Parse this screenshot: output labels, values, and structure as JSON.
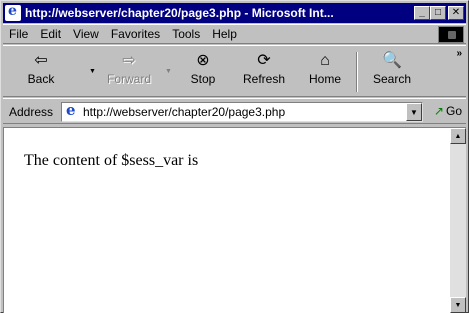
{
  "window": {
    "title": "http://webserver/chapter20/page3.php - Microsoft Int...",
    "minimize_label": "_",
    "maximize_label": "□",
    "close_label": "✕"
  },
  "menu": {
    "items": [
      {
        "label": "File"
      },
      {
        "label": "Edit"
      },
      {
        "label": "View"
      },
      {
        "label": "Favorites"
      },
      {
        "label": "Tools"
      },
      {
        "label": "Help"
      }
    ]
  },
  "toolbar": {
    "back": {
      "label": "Back",
      "icon": "⇦"
    },
    "forward": {
      "label": "Forward",
      "icon": "⇨"
    },
    "stop": {
      "label": "Stop",
      "icon": "⊗"
    },
    "refresh": {
      "label": "Refresh",
      "icon": "⟳"
    },
    "home": {
      "label": "Home",
      "icon": "⌂"
    },
    "search": {
      "label": "Search",
      "icon": "🔍"
    },
    "chevrons": "»"
  },
  "address": {
    "label": "Address",
    "url": "http://webserver/chapter20/page3.php",
    "go_label": "Go",
    "go_icon": "↗"
  },
  "page": {
    "text": "The content of $sess_var is"
  },
  "colors": {
    "titlebar": "#000080",
    "chrome": "#c0c0c0",
    "content_bg": "#ffffff"
  }
}
